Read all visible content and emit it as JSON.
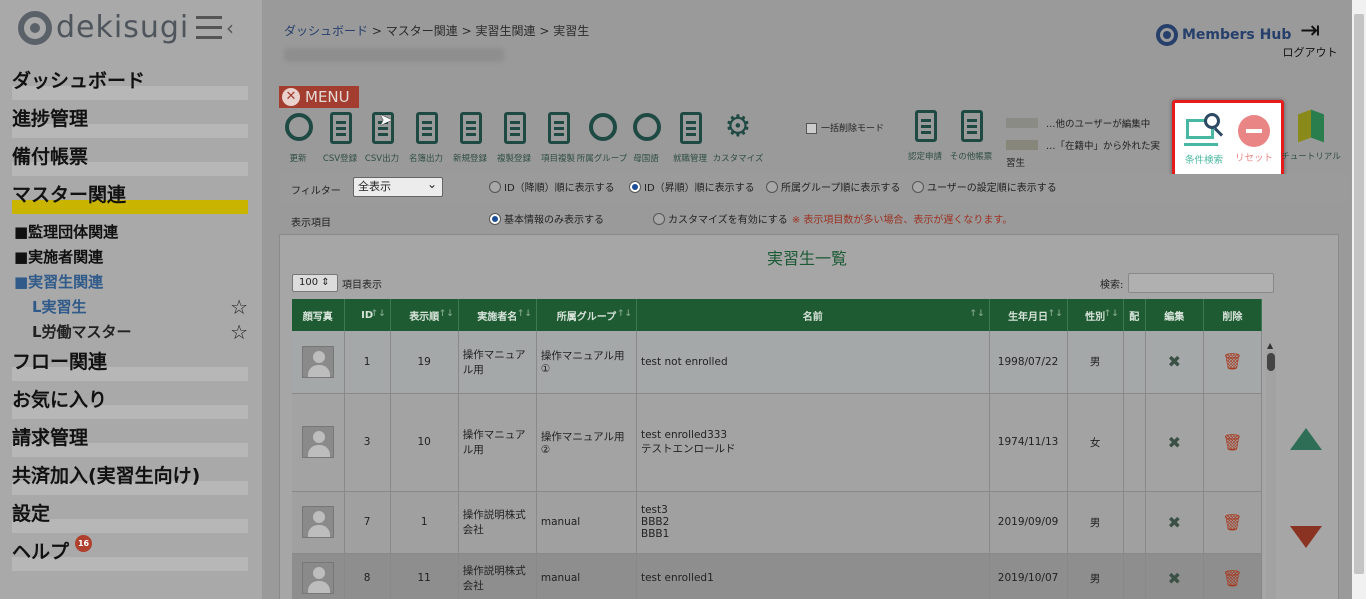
{
  "logo": {
    "text": "dekisugi"
  },
  "sidebar": {
    "items": [
      {
        "label": "ダッシュボード"
      },
      {
        "label": "進捗管理"
      },
      {
        "label": "備付帳票"
      },
      {
        "label": "マスター関連"
      }
    ],
    "sub_items": [
      {
        "label": "■監理団体関連"
      },
      {
        "label": "■実施者関連"
      },
      {
        "label": "■実習生関連"
      }
    ],
    "subsub_items": [
      {
        "label": "L実習生"
      },
      {
        "label": "L労働マスター"
      }
    ],
    "items2": [
      {
        "label": "フロー関連"
      },
      {
        "label": "お気に入り"
      },
      {
        "label": "請求管理"
      },
      {
        "label": "共済加入(実習生向け)"
      },
      {
        "label": "設定"
      },
      {
        "label": "ヘルプ"
      }
    ],
    "help_badge": "16"
  },
  "breadcrumb": {
    "dashboard": "ダッシュボード",
    "sep": ">",
    "master": "マスター関連",
    "trainee_rel": "実習生関連",
    "current": "実習生"
  },
  "header": {
    "members_hub": "Members Hub",
    "logout": "ログアウト",
    "menu": "MENU"
  },
  "toolbar": {
    "tools": [
      {
        "label": "更新"
      },
      {
        "label": "CSV登録"
      },
      {
        "label": "CSV出力"
      },
      {
        "label": "名簿出力"
      },
      {
        "label": "新規登録"
      },
      {
        "label": "複製登録"
      },
      {
        "label": "項目複製"
      },
      {
        "label": "所属グループ"
      },
      {
        "label": "母国語"
      },
      {
        "label": "就職管理"
      },
      {
        "label": "カスタマイズ"
      }
    ],
    "bulk_delete": "一括削除モード",
    "tools2": [
      {
        "label": "認定申請"
      },
      {
        "label": "その他帳票"
      }
    ],
    "legend1": "…他のユーザーが編集中",
    "legend2": "…「在籍中」から外れた実",
    "legend3": "習生",
    "search_label": "条件検索",
    "reset_label": "リセット",
    "tutorial_label": "チュートリアル"
  },
  "filter": {
    "label": "フィルター",
    "select_value": "全表示",
    "options": [
      "ID（降順）順に表示する",
      "ID（昇順）順に表示する",
      "所属グループ順に表示する",
      "ユーザーの設定順に表示する"
    ],
    "selected_index": 1
  },
  "display": {
    "label": "表示項目",
    "options": [
      "基本情報のみ表示する",
      "カスタマイズを有効にする"
    ],
    "warning": "※ 表示項目数が多い場合、表示が遅くなります。"
  },
  "table": {
    "title": "実習生一覧",
    "page_size": "100",
    "page_size_suffix": "項目表示",
    "search_label": "検索:",
    "headers": [
      "顔写真",
      "ID",
      "表示順",
      "実施者名",
      "所属グループ",
      "名前",
      "生年月日",
      "性別",
      "配",
      "編集",
      "削除"
    ],
    "no_image": "No Image",
    "rows": [
      {
        "id": "1",
        "order": "19",
        "company": "操作マニュアル用",
        "group": "操作マニュアル用①",
        "name": "test not enrolled",
        "birth": "1998/07/22",
        "gender": "男"
      },
      {
        "id": "3",
        "order": "10",
        "company": "操作マニュアル用",
        "group": "操作マニュアル用②",
        "name": "test enrolled333\nテストエンロールド",
        "birth": "1974/11/13",
        "gender": "女"
      },
      {
        "id": "7",
        "order": "1",
        "company": "操作説明株式会社",
        "group": "manual",
        "name": "test3\nBBB2\nBBB1",
        "birth": "2019/09/09",
        "gender": "男"
      },
      {
        "id": "8",
        "order": "11",
        "company": "操作説明株式会社",
        "group": "manual",
        "name": "test enrolled1",
        "birth": "2019/10/07",
        "gender": "男"
      }
    ]
  }
}
